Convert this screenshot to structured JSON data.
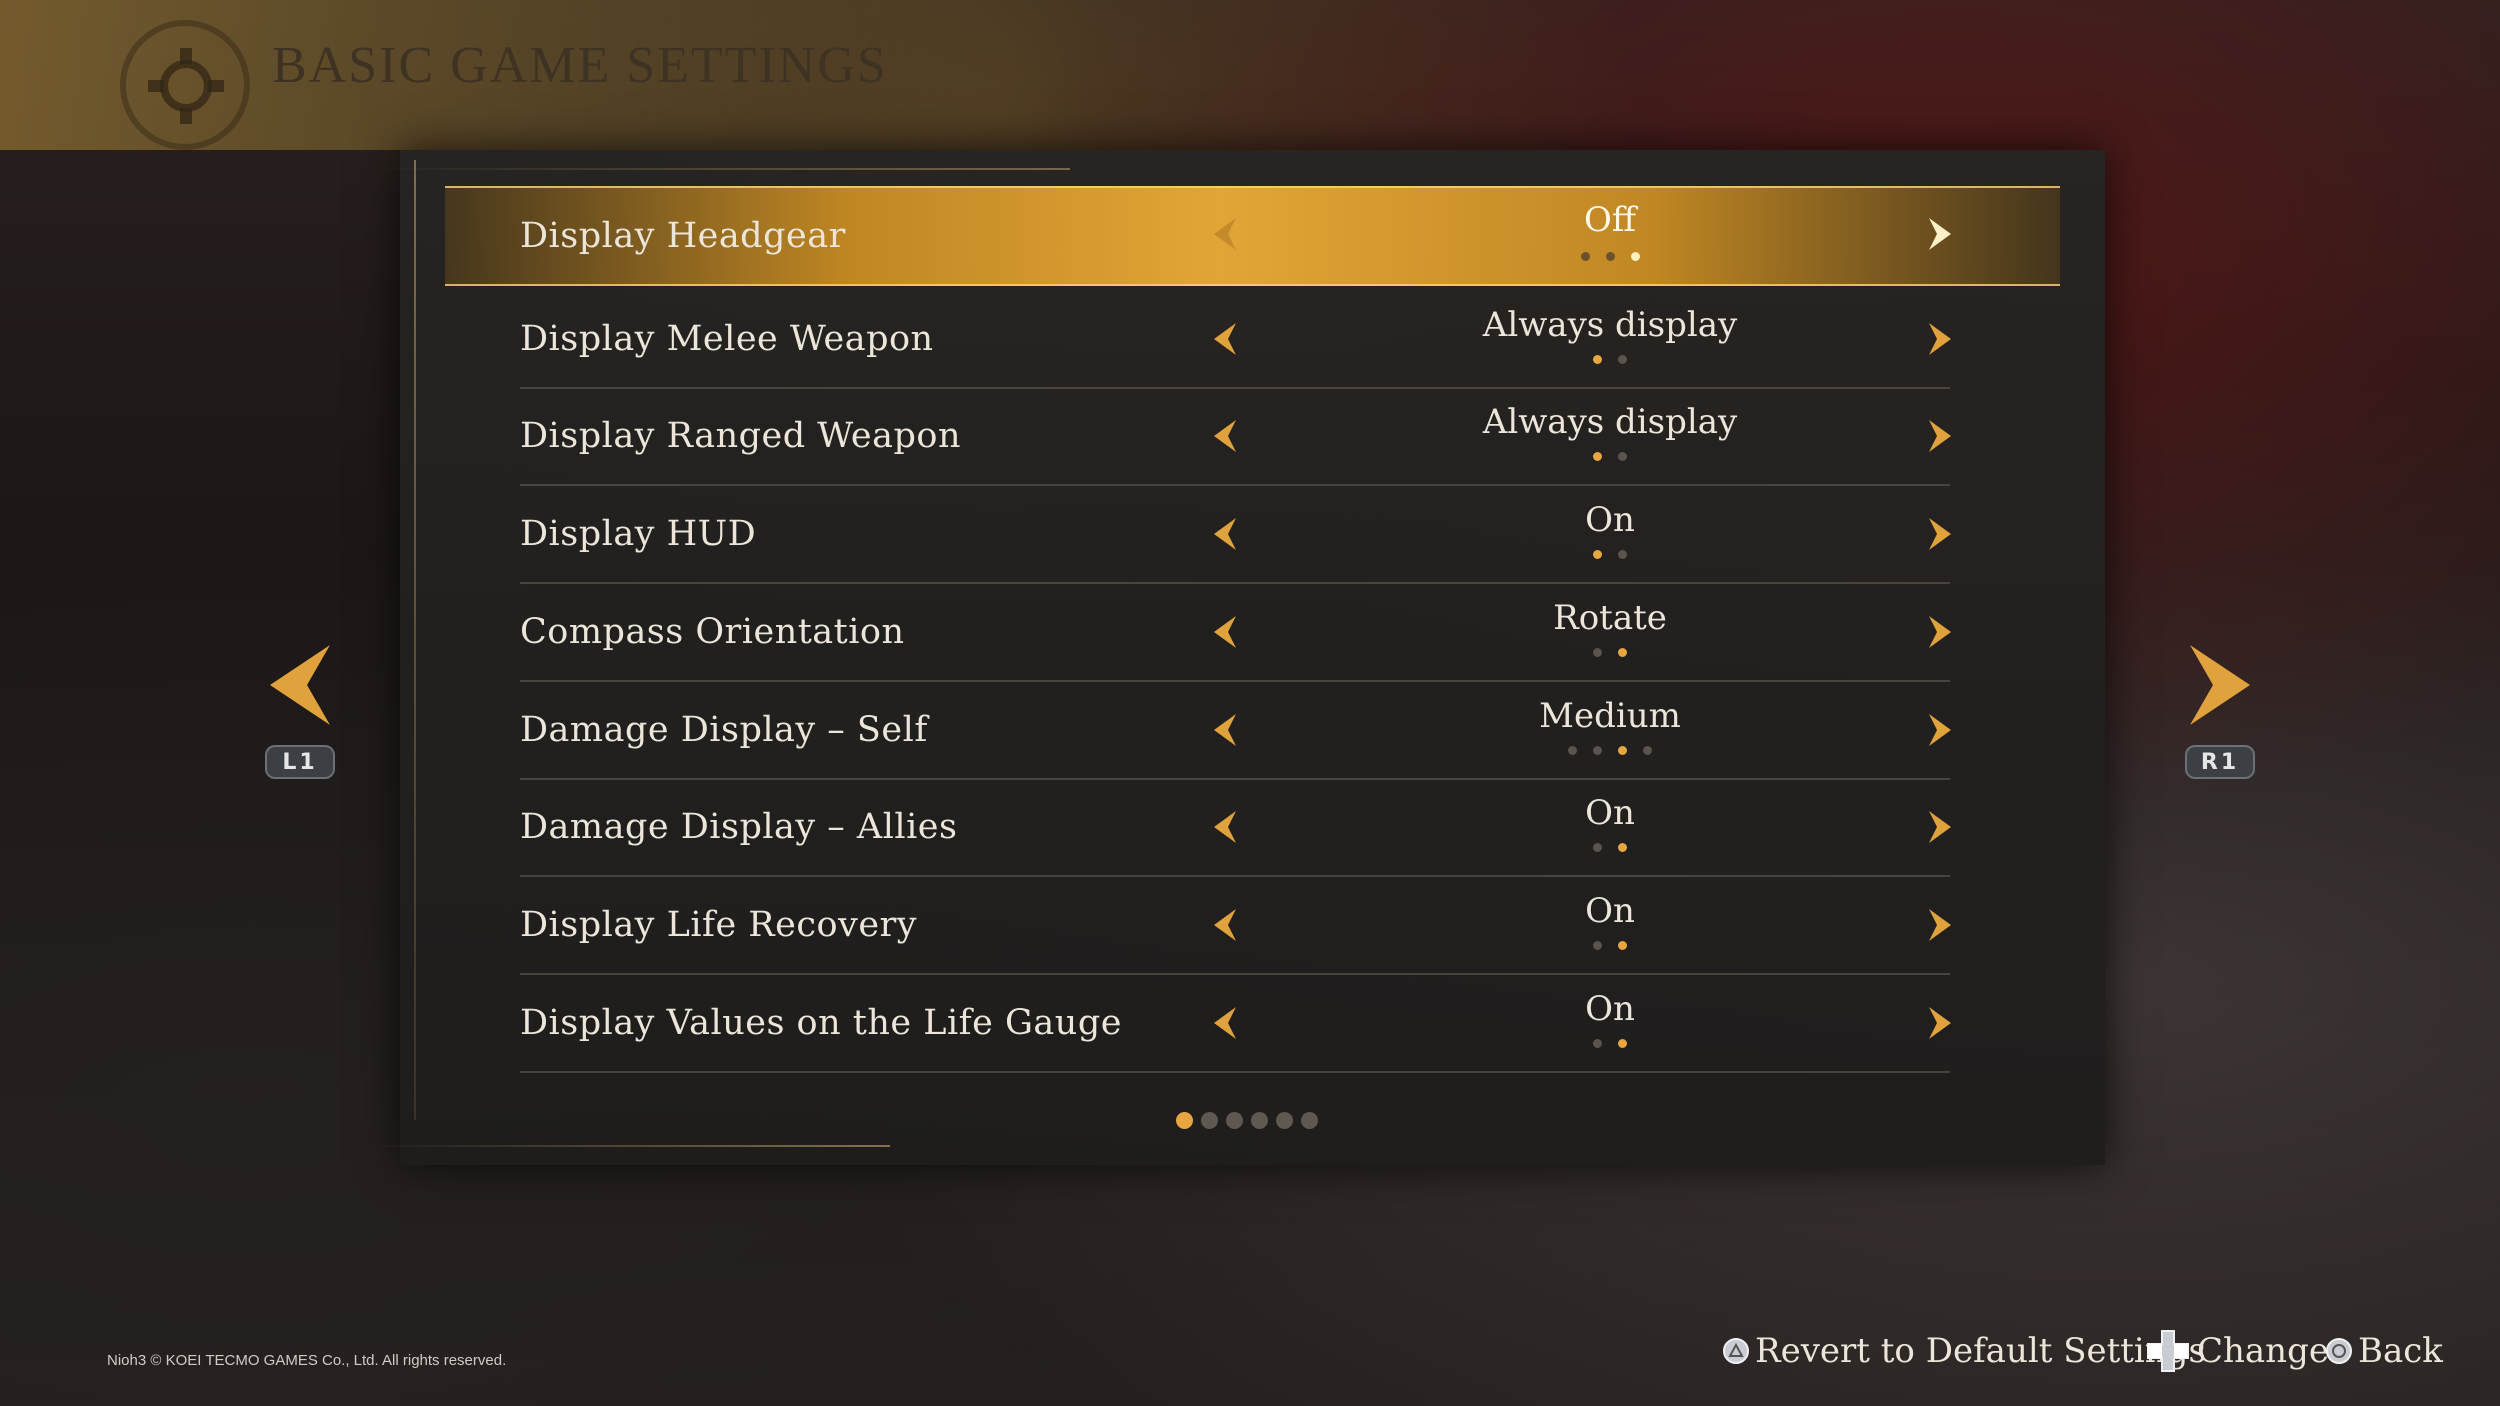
{
  "header": {
    "title": "Basic Game Settings",
    "icon": "gear-icon"
  },
  "settings": [
    {
      "label": "Display Headgear",
      "value": "Off",
      "options": 3,
      "index": 2,
      "selected": true
    },
    {
      "label": "Display Melee Weapon",
      "value": "Always display",
      "options": 2,
      "index": 0,
      "selected": false
    },
    {
      "label": "Display Ranged Weapon",
      "value": "Always display",
      "options": 2,
      "index": 0,
      "selected": false
    },
    {
      "label": "Display HUD",
      "value": "On",
      "options": 2,
      "index": 0,
      "selected": false
    },
    {
      "label": "Compass Orientation",
      "value": "Rotate",
      "options": 2,
      "index": 1,
      "selected": false
    },
    {
      "label": "Damage Display – Self",
      "value": "Medium",
      "options": 4,
      "index": 2,
      "selected": false
    },
    {
      "label": "Damage Display – Allies",
      "value": "On",
      "options": 2,
      "index": 1,
      "selected": false
    },
    {
      "label": "Display Life Recovery",
      "value": "On",
      "options": 2,
      "index": 1,
      "selected": false
    },
    {
      "label": "Display Values on the Life Gauge",
      "value": "On",
      "options": 2,
      "index": 1,
      "selected": false
    }
  ],
  "pagination": {
    "pages": 6,
    "current": 0
  },
  "nav": {
    "left_button": "L1",
    "right_button": "R1"
  },
  "footer": {
    "copyright": "Nioh3 © KOEI TECMO GAMES Co., Ltd. All rights reserved.",
    "revert": "Revert to Default Settings",
    "change": "Change",
    "back": "Back"
  },
  "colors": {
    "accent": "#e8a640",
    "text": "#ece6da",
    "panel": "#262422"
  }
}
